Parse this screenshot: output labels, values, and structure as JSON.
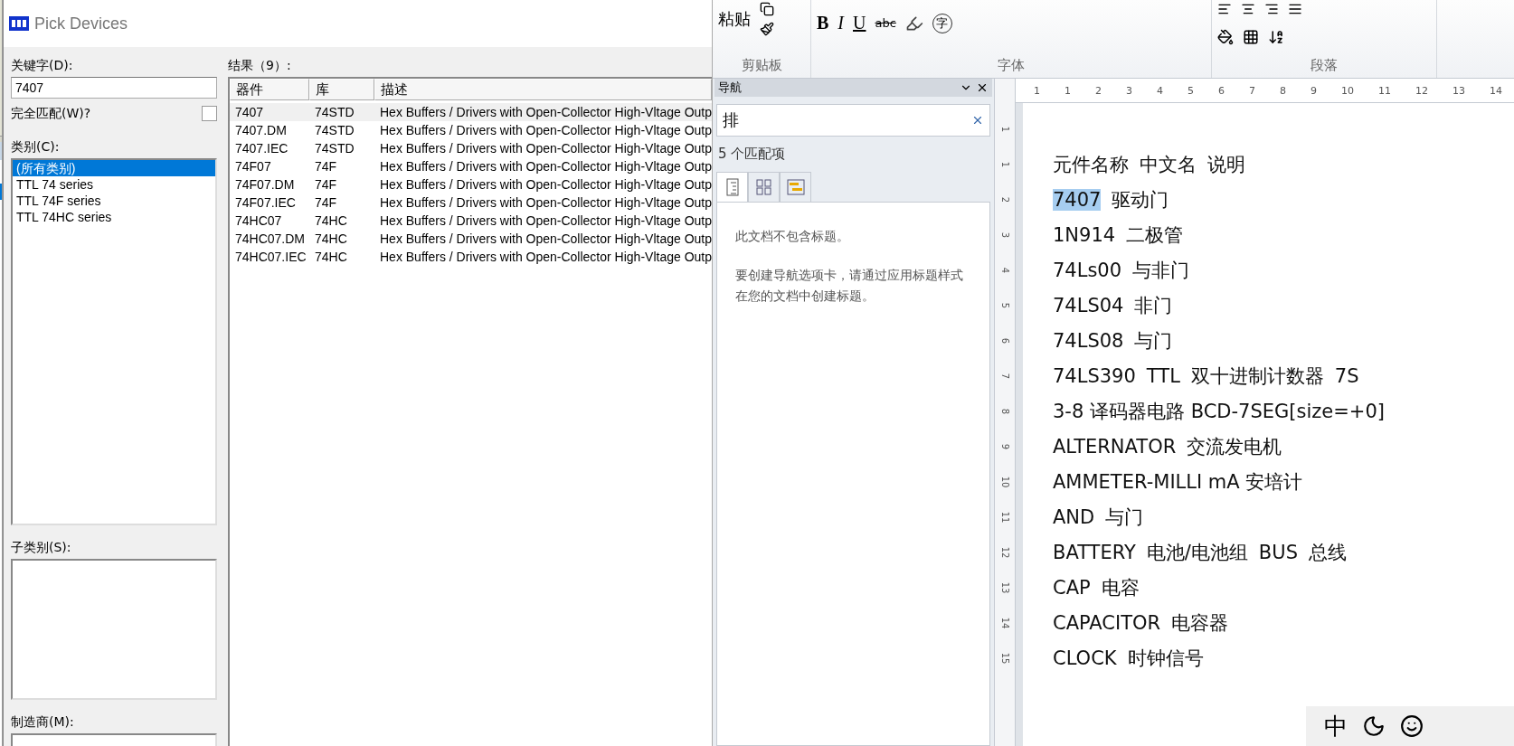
{
  "dialog": {
    "title": "Pick Devices",
    "keyword": {
      "label": "关键字(D):",
      "value": "7407"
    },
    "exact_match": {
      "label": "完全匹配(W)?",
      "checked": false
    },
    "category": {
      "label": "类别(C):",
      "items": [
        {
          "label": "(所有类别)",
          "selected": true
        },
        {
          "label": "TTL 74 series",
          "selected": false
        },
        {
          "label": "TTL 74F series",
          "selected": false
        },
        {
          "label": "TTL 74HC series",
          "selected": false
        }
      ]
    },
    "subcategory": {
      "label": "子类别(S):"
    },
    "manufacturer": {
      "label": "制造商(M):"
    },
    "results": {
      "label": "结果（9）:",
      "columns": [
        "器件",
        "库",
        "描述"
      ],
      "rows": [
        {
          "cells": [
            "7407",
            "74STD",
            "Hex Buffers / Drivers with Open-Collector High-Vltage Outp"
          ],
          "selected": true
        },
        {
          "cells": [
            "7407.DM",
            "74STD",
            "Hex Buffers / Drivers with Open-Collector High-Vltage Outp"
          ],
          "selected": false
        },
        {
          "cells": [
            "7407.IEC",
            "74STD",
            "Hex Buffers / Drivers with Open-Collector High-Vltage Outp"
          ],
          "selected": false
        },
        {
          "cells": [
            "74F07",
            "74F",
            "Hex Buffers / Drivers with Open-Collector High-Vltage Outp"
          ],
          "selected": false
        },
        {
          "cells": [
            "74F07.DM",
            "74F",
            "Hex Buffers / Drivers with Open-Collector High-Vltage Outp"
          ],
          "selected": false
        },
        {
          "cells": [
            "74F07.IEC",
            "74F",
            "Hex Buffers / Drivers with Open-Collector High-Vltage Outp"
          ],
          "selected": false
        },
        {
          "cells": [
            "74HC07",
            "74HC",
            "Hex Buffers / Drivers with Open-Collector High-Vltage Outp"
          ],
          "selected": false
        },
        {
          "cells": [
            "74HC07.DM",
            "74HC",
            "Hex Buffers / Drivers with Open-Collector High-Vltage Outp"
          ],
          "selected": false
        },
        {
          "cells": [
            "74HC07.IEC",
            "74HC",
            "Hex Buffers / Drivers with Open-Collector High-Vltage Outp"
          ],
          "selected": false
        }
      ]
    }
  },
  "ribbon": {
    "groups": [
      {
        "kind": "clipboard",
        "label": "剪贴板",
        "paste": "粘贴"
      },
      {
        "kind": "font",
        "label": "字体",
        "keys": [
          "B",
          "I",
          "U"
        ],
        "strike": "abc",
        "enclosed": "字"
      },
      {
        "kind": "paragraph",
        "label": "段落"
      }
    ]
  },
  "navigation": {
    "title": "导航",
    "search": {
      "value": "排"
    },
    "match_count": "5 个匹配项",
    "tabs": [
      {
        "kind": "headings",
        "selected": true
      },
      {
        "kind": "pages",
        "selected": false
      },
      {
        "kind": "results",
        "selected": false
      }
    ],
    "messages": [
      "此文档不包含标题。",
      "要创建导航选项卡，请通过应用标题样式在您的文档中创建标题。"
    ]
  },
  "rulers": {
    "horizontal": [
      "1",
      "1",
      "2",
      "3",
      "4",
      "5",
      "6",
      "7",
      "8",
      "9",
      "10",
      "11",
      "12",
      "13",
      "14"
    ],
    "vertical": [
      "1",
      "1",
      "2",
      "3",
      "4",
      "5",
      "6",
      "7",
      "8",
      "9",
      "10",
      "11",
      "12",
      "13",
      "14",
      "15"
    ]
  },
  "document": {
    "lines": [
      {
        "parts": [
          {
            "text": "元件名称",
            "selected": false
          },
          {
            "text": "中文名",
            "selected": false
          },
          {
            "text": "说明",
            "selected": false
          }
        ]
      },
      {
        "parts": [
          {
            "text": "7407",
            "selected": true
          },
          {
            "text": "驱动门",
            "selected": false
          }
        ]
      },
      {
        "parts": [
          {
            "text": "1N914",
            "selected": false
          },
          {
            "text": "二极管",
            "selected": false
          }
        ]
      },
      {
        "parts": [
          {
            "text": "74Ls00",
            "selected": false
          },
          {
            "text": "与非门",
            "selected": false
          }
        ]
      },
      {
        "parts": [
          {
            "text": "74LS04",
            "selected": false
          },
          {
            "text": "非门",
            "selected": false
          }
        ]
      },
      {
        "parts": [
          {
            "text": "74LS08",
            "selected": false
          },
          {
            "text": "与门",
            "selected": false
          }
        ]
      },
      {
        "parts": [
          {
            "text": "74LS390",
            "selected": false
          },
          {
            "text": "TTL",
            "selected": false
          },
          {
            "text": "双十进制计数器",
            "selected": false
          },
          {
            "text": "7S",
            "selected": false
          }
        ]
      },
      {
        "parts": [
          {
            "text": "3-8 译码器电路 BCD-7SEG[size=+0]",
            "selected": false
          }
        ]
      },
      {
        "parts": [
          {
            "text": "ALTERNATOR",
            "selected": false
          },
          {
            "text": "交流发电机",
            "selected": false
          }
        ]
      },
      {
        "parts": [
          {
            "text": "AMMETER-MILLI mA 安培计",
            "selected": false
          }
        ]
      },
      {
        "parts": [
          {
            "text": "AND",
            "selected": false
          },
          {
            "text": "与门",
            "selected": false
          }
        ]
      },
      {
        "parts": [
          {
            "text": "BATTERY",
            "selected": false
          },
          {
            "text": "电池/电池组",
            "selected": false
          },
          {
            "text": "BUS",
            "selected": false
          },
          {
            "text": "总线",
            "selected": false
          }
        ]
      },
      {
        "parts": [
          {
            "text": "CAP",
            "selected": false
          },
          {
            "text": "电容",
            "selected": false
          }
        ]
      },
      {
        "parts": [
          {
            "text": "CAPACITOR",
            "selected": false
          },
          {
            "text": "电容器",
            "selected": false
          }
        ]
      },
      {
        "parts": [
          {
            "text": "CLOCK",
            "selected": false
          },
          {
            "text": "时钟信号",
            "selected": false
          }
        ]
      }
    ]
  },
  "ime_bar": {
    "mode": "中"
  }
}
